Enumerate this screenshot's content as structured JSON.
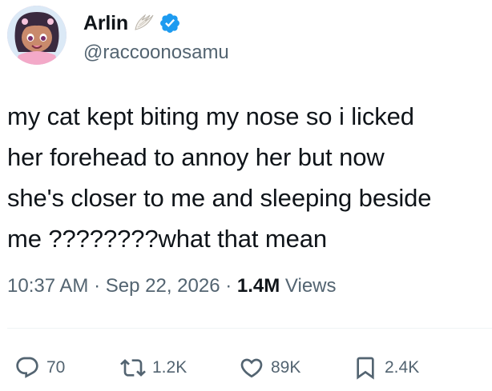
{
  "user": {
    "display_name": "Arlin",
    "handle": "@raccoonosamu",
    "icons": [
      "angel-wing-emoji-icon",
      "verified-badge-icon"
    ],
    "verified_color": "#1d9bf0"
  },
  "tweet": {
    "lines": [
      "my cat kept biting my nose so i licked",
      "her forehead to annoy her but now",
      "she's closer to me and sleeping beside",
      "me ????????what that mean"
    ]
  },
  "meta": {
    "time": "10:37 AM",
    "separator": "·",
    "date": "Sep 22, 2026",
    "views_count": "1.4M",
    "views_label": "Views"
  },
  "actions": {
    "replies": "70",
    "reposts": "1.2K",
    "likes": "89K",
    "bookmarks": "2.4K",
    "icon_color": "#536471"
  }
}
